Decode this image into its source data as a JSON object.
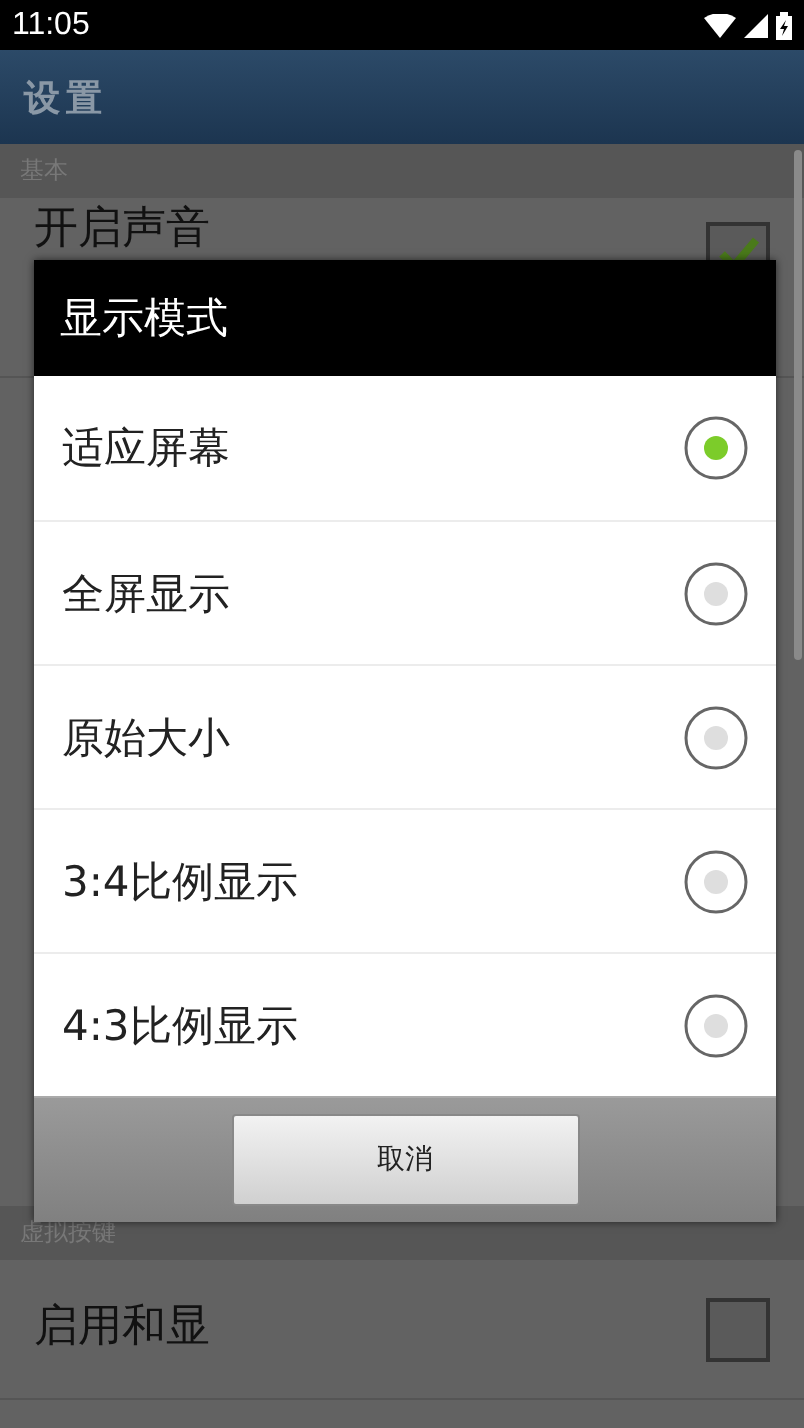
{
  "status_bar": {
    "time": "11:05"
  },
  "app_bar": {
    "title": "设置"
  },
  "settings": [
    {
      "kind": "section",
      "title": "基本"
    },
    {
      "kind": "checkbox",
      "title": "开启声音",
      "checked": true
    },
    {
      "kind": "gap"
    },
    {
      "kind": "section",
      "title": "虚拟按键"
    },
    {
      "kind": "checkbox",
      "title": "启用和显",
      "checked": false
    }
  ],
  "dialog": {
    "title": "显示模式",
    "options": [
      {
        "label": "适应屏幕",
        "selected": true
      },
      {
        "label": "全屏显示",
        "selected": false
      },
      {
        "label": "原始大小",
        "selected": false
      },
      {
        "label": "3:4比例显示",
        "selected": false
      },
      {
        "label": "4:3比例显示",
        "selected": false
      }
    ],
    "cancel": "取消"
  }
}
